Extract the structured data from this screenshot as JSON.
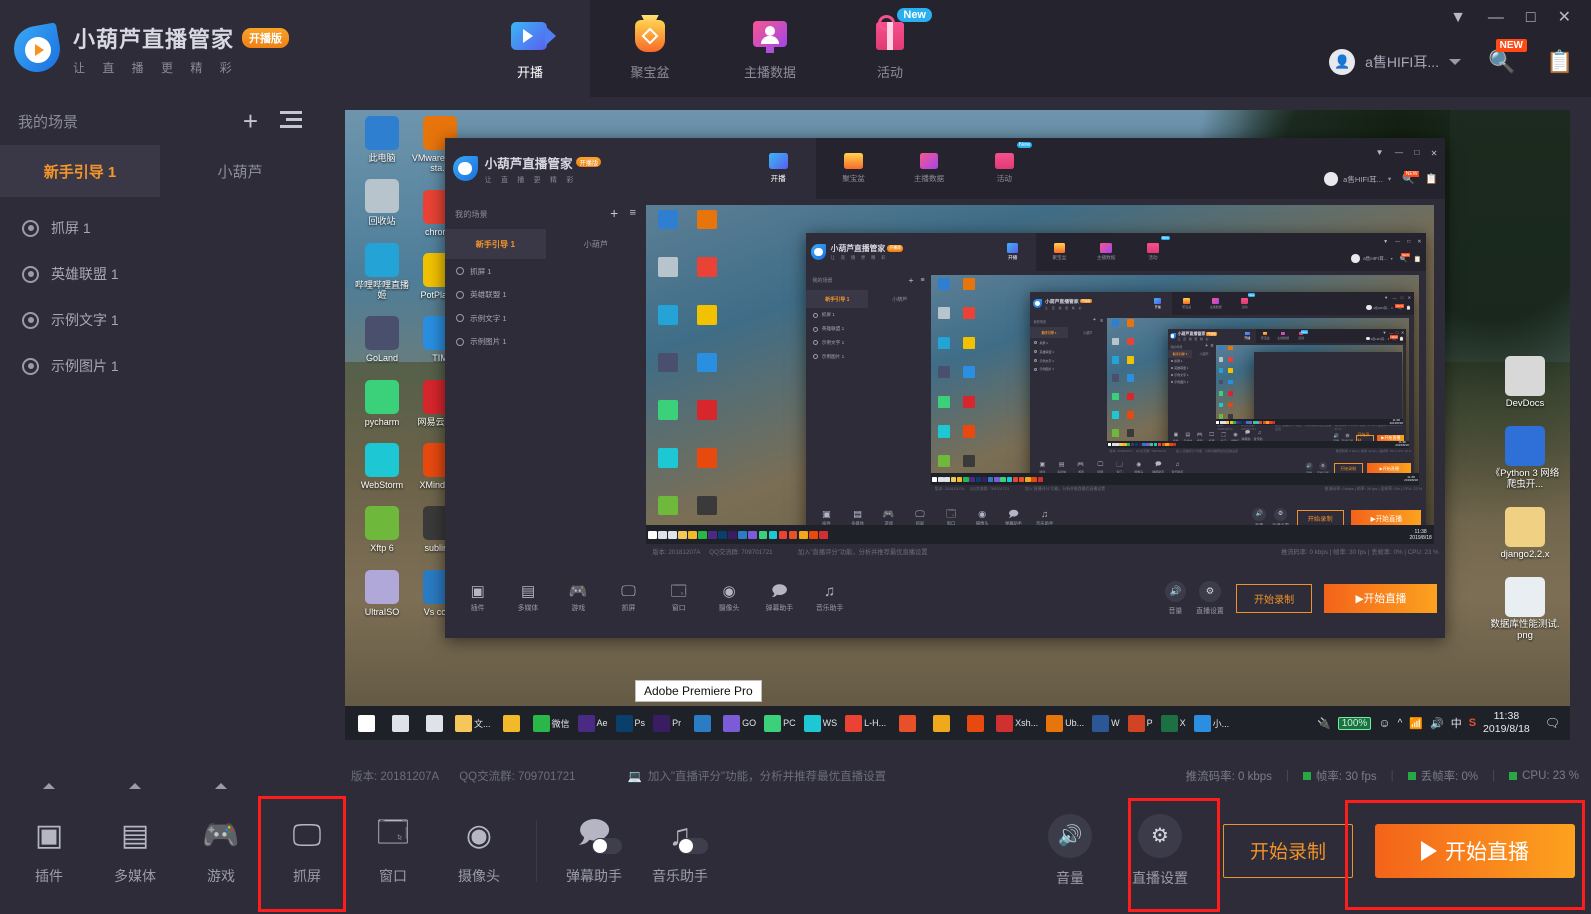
{
  "app": {
    "title": "小葫芦直播管家",
    "subtitle": "让 直 播 更 精 彩",
    "badge": "开播版"
  },
  "header": {
    "nav": [
      {
        "label": "开播",
        "icon": "broadcast-icon",
        "active": true,
        "badge": ""
      },
      {
        "label": "聚宝盆",
        "icon": "treasure-bag-icon",
        "active": false,
        "badge": ""
      },
      {
        "label": "主播数据",
        "icon": "anchor-data-icon",
        "active": false,
        "badge": ""
      },
      {
        "label": "活动",
        "icon": "gift-icon",
        "active": false,
        "badge": "New"
      }
    ],
    "user": {
      "name": "a售HIFI耳...",
      "avatar": "avatar-icon"
    },
    "search_badge": "NEW",
    "window_controls": {
      "collapse": "▼",
      "minimize": "—",
      "maximize": "□",
      "close": "✕"
    }
  },
  "sidebar": {
    "scene_title": "我的场景",
    "add_label": "+",
    "tabs": [
      {
        "label": "新手引导 1",
        "active": true
      },
      {
        "label": "小葫芦",
        "active": false
      }
    ],
    "layers": [
      {
        "label": "抓屏 1"
      },
      {
        "label": "英雄联盟 1"
      },
      {
        "label": "示例文字 1"
      },
      {
        "label": "示例图片 1"
      }
    ]
  },
  "toolbar": {
    "tools": [
      {
        "label": "插件",
        "icon": "plugin-icon",
        "has_arrow": true,
        "toggle": false,
        "highlight": false
      },
      {
        "label": "多媒体",
        "icon": "multimedia-icon",
        "has_arrow": true,
        "toggle": false,
        "highlight": false
      },
      {
        "label": "游戏",
        "icon": "game-icon",
        "has_arrow": true,
        "toggle": false,
        "highlight": false
      },
      {
        "label": "抓屏",
        "icon": "screen-capture-icon",
        "has_arrow": false,
        "toggle": false,
        "highlight": true
      },
      {
        "label": "窗口",
        "icon": "window-icon",
        "has_arrow": false,
        "toggle": false,
        "highlight": false
      },
      {
        "label": "摄像头",
        "icon": "webcam-icon",
        "has_arrow": false,
        "toggle": false,
        "highlight": false
      },
      {
        "label": "弹幕助手",
        "icon": "danmaku-assistant-icon",
        "has_arrow": false,
        "toggle": true,
        "highlight": false
      },
      {
        "label": "音乐助手",
        "icon": "music-assistant-icon",
        "has_arrow": false,
        "toggle": true,
        "highlight": false
      }
    ],
    "volume_label": "音量",
    "settings_label": "直播设置",
    "record_button": "开始录制",
    "live_button": "开始直播"
  },
  "statusbar": {
    "version": "版本: 20181207A",
    "qq_group": "QQ交流群: 709701721",
    "promo": "加入\"直播评分\"功能，分析并推荐最优直播设置",
    "bitrate": "推流码率: 0 kbps",
    "fps": "帧率: 30 fps",
    "droprate": "丢帧率: 0%",
    "cpu": "CPU: 23 %"
  },
  "desktop": {
    "icons_col1": [
      {
        "label": "此电脑",
        "color": "#2f7fd0"
      },
      {
        "label": "回收站",
        "color": "#b8c4cc"
      },
      {
        "label": "哔哩哔哩直播姬",
        "color": "#24a3d6"
      },
      {
        "label": "GoLand",
        "color": "#4a4f6e"
      },
      {
        "label": "pycharm",
        "color": "#3bd17a"
      },
      {
        "label": "WebStorm",
        "color": "#1ec7d4"
      },
      {
        "label": "Xftp 6",
        "color": "#6eb83c"
      },
      {
        "label": "UltraISO",
        "color": "#b0a8d8"
      }
    ],
    "icons_col2": [
      {
        "label": "VMware Worksta...",
        "color": "#e8740c"
      },
      {
        "label": "chrome",
        "color": "#ea4335"
      },
      {
        "label": "PotPlayer",
        "color": "#f2c200"
      },
      {
        "label": "TIM",
        "color": "#2a8fe0"
      },
      {
        "label": "网易云音乐",
        "color": "#d7262c"
      },
      {
        "label": "XMind Z...",
        "color": "#e8490f"
      },
      {
        "label": "sublime",
        "color": "#3a3a3a"
      },
      {
        "label": "Vs code",
        "color": "#2b7cc4"
      }
    ],
    "icons_right": [
      {
        "label": "DevDocs",
        "color": "#d8d8d8"
      },
      {
        "label": "《Python 3 网络爬虫开...",
        "color": "#2f6fd8"
      },
      {
        "label": "django2.2.x",
        "color": "#f0d184"
      },
      {
        "label": "数据库性能测试.png",
        "color": "#e9eef3"
      }
    ],
    "taskbar": {
      "tooltip": "Adobe Premiere Pro",
      "items": [
        {
          "label": "start-icon",
          "color": "#ffffff"
        },
        {
          "label": "cortana-icon",
          "color": "#dfe3e8"
        },
        {
          "label": "taskview-icon",
          "color": "#dfe3e8"
        },
        {
          "label": "文...",
          "color": "#f5c65a"
        },
        {
          "label": "browser-icon",
          "color": "#f2b92b"
        },
        {
          "label": "微信",
          "color": "#2ab74a"
        },
        {
          "label": "Ae",
          "color": "#4b2a86"
        },
        {
          "label": "Ps",
          "color": "#0b3f6b"
        },
        {
          "label": "Pr",
          "color": "#3a1c63"
        },
        {
          "label": "vscode-icon",
          "color": "#2b7cc4"
        },
        {
          "label": "GO",
          "color": "#7b5bd6"
        },
        {
          "label": "PC",
          "color": "#3bd17a"
        },
        {
          "label": "WS",
          "color": "#1ec7d4"
        },
        {
          "label": "L-H...",
          "color": "#ea4335"
        },
        {
          "label": "opera-icon",
          "color": "#e8502a"
        },
        {
          "label": "sublime-icon",
          "color": "#f0a81c"
        },
        {
          "label": "xmind-icon",
          "color": "#e8490f"
        },
        {
          "label": "Xsh...",
          "color": "#d03030"
        },
        {
          "label": "Ub...",
          "color": "#e8740c"
        },
        {
          "label": "W",
          "color": "#2b5797"
        },
        {
          "label": "P",
          "color": "#d04423"
        },
        {
          "label": "X",
          "color": "#1d7044"
        },
        {
          "label": "小...",
          "color": "#2a8fe0"
        }
      ],
      "battery": "100%",
      "ime": "中",
      "sogou": "S",
      "time": "11:38",
      "date": "2019/8/18"
    }
  }
}
